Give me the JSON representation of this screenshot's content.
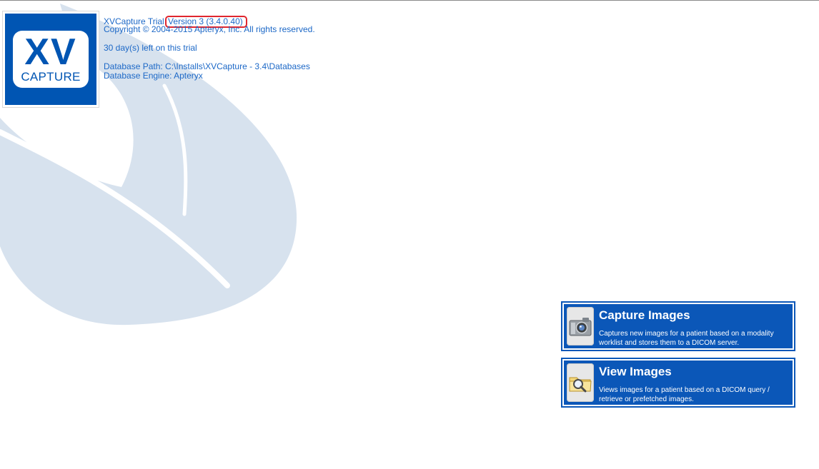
{
  "about": {
    "app_name": "XVCapture Trial",
    "version": "Version 3 (3.4.0.40)",
    "copyright": "Copyright © 2004-2015 Apteryx, Inc. All rights reserved.",
    "trial_status": "30 day(s) left on this trial",
    "database_path": "Database Path: C:\\Installs\\XVCapture - 3.4\\Databases",
    "database_engine": "Database Engine: Apteryx"
  },
  "logo": {
    "line1": "XV",
    "line2": "CAPTURE",
    "brand_color": "#0055b3"
  },
  "actions": [
    {
      "icon": "camera-icon",
      "title": "Capture Images",
      "description": "Captures new images for a patient based on a modality worklist and stores them to a DICOM server."
    },
    {
      "icon": "folder-magnifier-icon",
      "title": "View Images",
      "description": "Views images for a patient based on a DICOM query / retrieve or prefetched images."
    }
  ],
  "colors": {
    "info_text": "#1c68c7",
    "card_background": "#0b57b8",
    "highlight_border": "#e0262e",
    "watermark": "#d7e2ee"
  }
}
